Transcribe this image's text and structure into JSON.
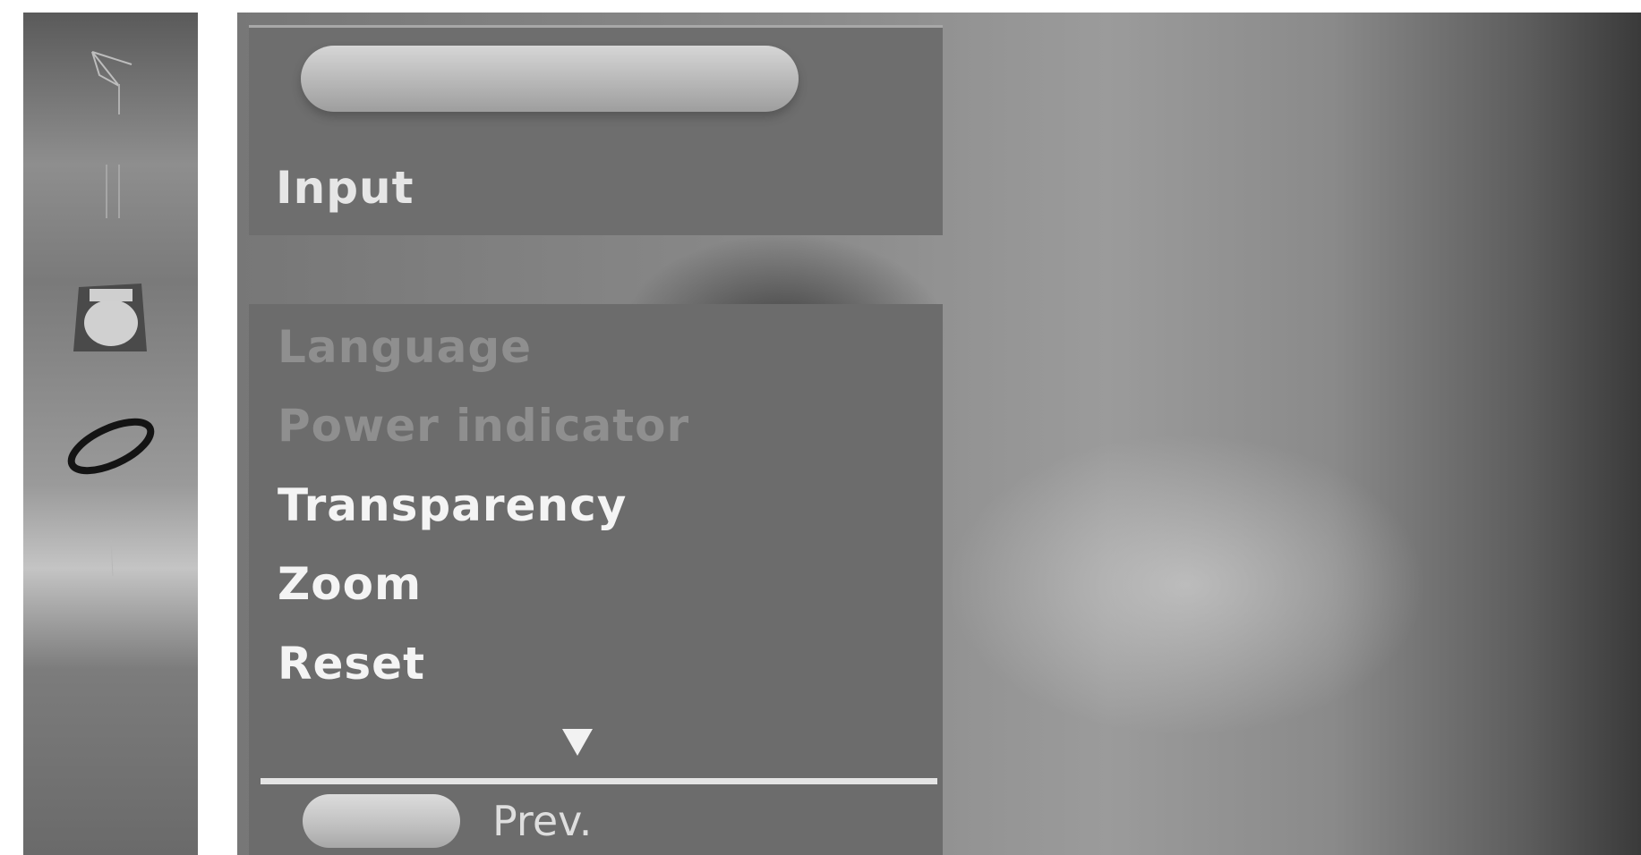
{
  "header": {
    "title": "Input"
  },
  "menu": {
    "items": [
      {
        "label": "Language",
        "enabled": false
      },
      {
        "label": "Power indicator",
        "enabled": false
      },
      {
        "label": "Transparency",
        "enabled": true
      },
      {
        "label": "Zoom",
        "enabled": true
      },
      {
        "label": "Reset",
        "enabled": true
      }
    ],
    "scroll_indicator": "down-arrow-icon"
  },
  "footer": {
    "prev_label": "Prev."
  },
  "sidebar": {
    "icons": [
      "picture-tool-icon",
      "bars-icon",
      "screen-setup-icon",
      "disc-icon",
      "faint-glyph-icon"
    ]
  },
  "colors": {
    "panel": "#6c6c6c",
    "text_enabled": "#f4f4f4",
    "text_disabled": "#8f8f8f",
    "divider": "#e4e4e4"
  }
}
